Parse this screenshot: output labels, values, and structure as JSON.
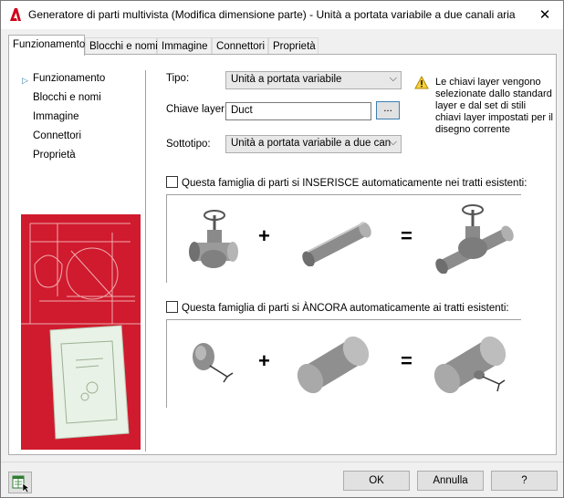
{
  "window": {
    "title": "Generatore di parti multivista (Modifica dimensione parte) - Unità a portata variabile a due canali aria",
    "close_glyph": "✕",
    "app_icon": "autocad-a-icon"
  },
  "tabs": [
    {
      "label": "Funzionamento",
      "active": true
    },
    {
      "label": "Blocchi e nomi",
      "active": false
    },
    {
      "label": "Immagine",
      "active": false
    },
    {
      "label": "Connettori",
      "active": false
    },
    {
      "label": "Proprietà",
      "active": false
    }
  ],
  "nav": {
    "items": [
      {
        "label": "Funzionamento",
        "selected": true
      },
      {
        "label": "Blocchi e nomi",
        "selected": false
      },
      {
        "label": "Immagine",
        "selected": false
      },
      {
        "label": "Connettori",
        "selected": false
      },
      {
        "label": "Proprietà",
        "selected": false
      }
    ]
  },
  "form": {
    "tipo_label": "Tipo:",
    "tipo_value": "Unità a portata variabile",
    "chiave_label": "Chiave layer:",
    "chiave_value": "Duct",
    "browse_label": "...",
    "sottotipo_label": "Sottotipo:",
    "sottotipo_value": "Unità a portata variabile a due can"
  },
  "info": {
    "icon": "warning-icon",
    "text": "Le chiavi layer vengono selezionate dallo standard layer e dal set di stili chiavi layer impostati per il disegno corrente"
  },
  "insert_section": {
    "label": "Questa famiglia di parti si INSERISCE automaticamente nei tratti esistenti:",
    "checked": false,
    "plus": "+",
    "equals": "="
  },
  "anchor_section": {
    "label": "Questa famiglia di parti si ÀNCORA automaticamente ai tratti esistenti:",
    "checked": false,
    "plus": "+",
    "equals": "="
  },
  "buttons": {
    "ok": "OK",
    "cancel": "Annulla",
    "help": "?"
  },
  "colors": {
    "accent": "#3c7fb1",
    "side_image_red": "#c8102e",
    "side_image_light": "#f2c8c8"
  }
}
